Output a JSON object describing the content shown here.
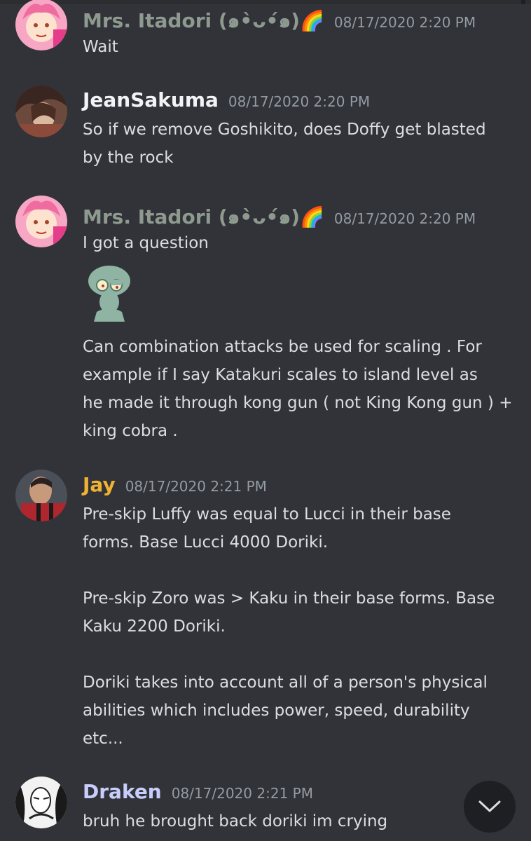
{
  "messages": [
    {
      "author": "Mrs. Itadori (๑•̀ᴗ•́๑)🌈",
      "timestamp": "08/17/2020 2:20 PM",
      "name_color": "#8e9a8f",
      "lines": [
        "Wait"
      ]
    },
    {
      "author": "JeanSakuma",
      "timestamp": "08/17/2020 2:20 PM",
      "name_color": "#f2f3f5",
      "lines": [
        "So if we remove Goshikito, does Doffy get blasted",
        "by the rock"
      ]
    },
    {
      "author": "Mrs. Itadori (๑•̀ᴗ•́๑)🌈",
      "timestamp": "08/17/2020 2:20 PM",
      "name_color": "#8e9a8f",
      "lines": [
        "I got a question"
      ],
      "sticker": "squidward-sticker",
      "lines2": [
        "Can combination attacks be used for scaling . For",
        "example if I say Katakuri scales to island level as",
        "he made it through kong gun ( not King Kong gun ) +",
        "king cobra ."
      ]
    },
    {
      "author": "Jay",
      "timestamp": "08/17/2020 2:21 PM",
      "name_color": "#f0b232",
      "lines": [
        "Pre-skip Luffy was equal to Lucci in their base",
        "forms. Base Lucci 4000 Doriki.",
        "",
        "Pre-skip Zoro was > Kaku in their base forms. Base",
        "Kaku 2200 Doriki.",
        "",
        "Doriki takes into account all of a person's physical",
        "abilities which includes power, speed, durability",
        "etc..."
      ]
    },
    {
      "author": "Draken",
      "timestamp": "08/17/2020 2:21 PM",
      "name_color": "#c9cdfb",
      "lines": [
        "bruh he brought back doriki im crying"
      ]
    }
  ],
  "scroll_button": {
    "icon": "chevron-down-icon"
  }
}
